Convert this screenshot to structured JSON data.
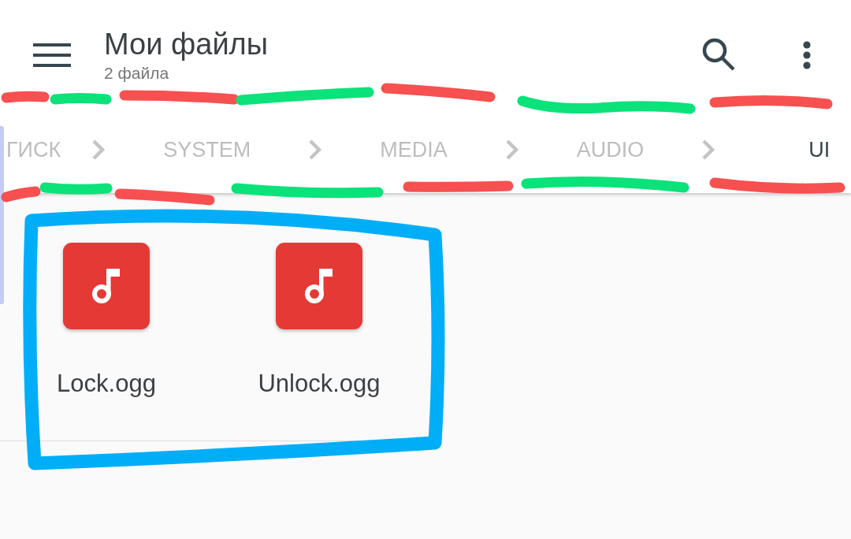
{
  "app_bar": {
    "title": "Мои файлы",
    "subtitle": "2 файла"
  },
  "breadcrumbs": [
    {
      "label": "ГИСК",
      "selected": false
    },
    {
      "label": "SYSTEM",
      "selected": false
    },
    {
      "label": "MEDIA",
      "selected": false
    },
    {
      "label": "AUDIO",
      "selected": false
    },
    {
      "label": "UI",
      "selected": true
    }
  ],
  "files": [
    {
      "name": "Lock.ogg",
      "kind": "audio"
    },
    {
      "name": "Unlock.ogg",
      "kind": "audio"
    }
  ],
  "annotations": {
    "dashed_lines": true,
    "files_box": true
  }
}
